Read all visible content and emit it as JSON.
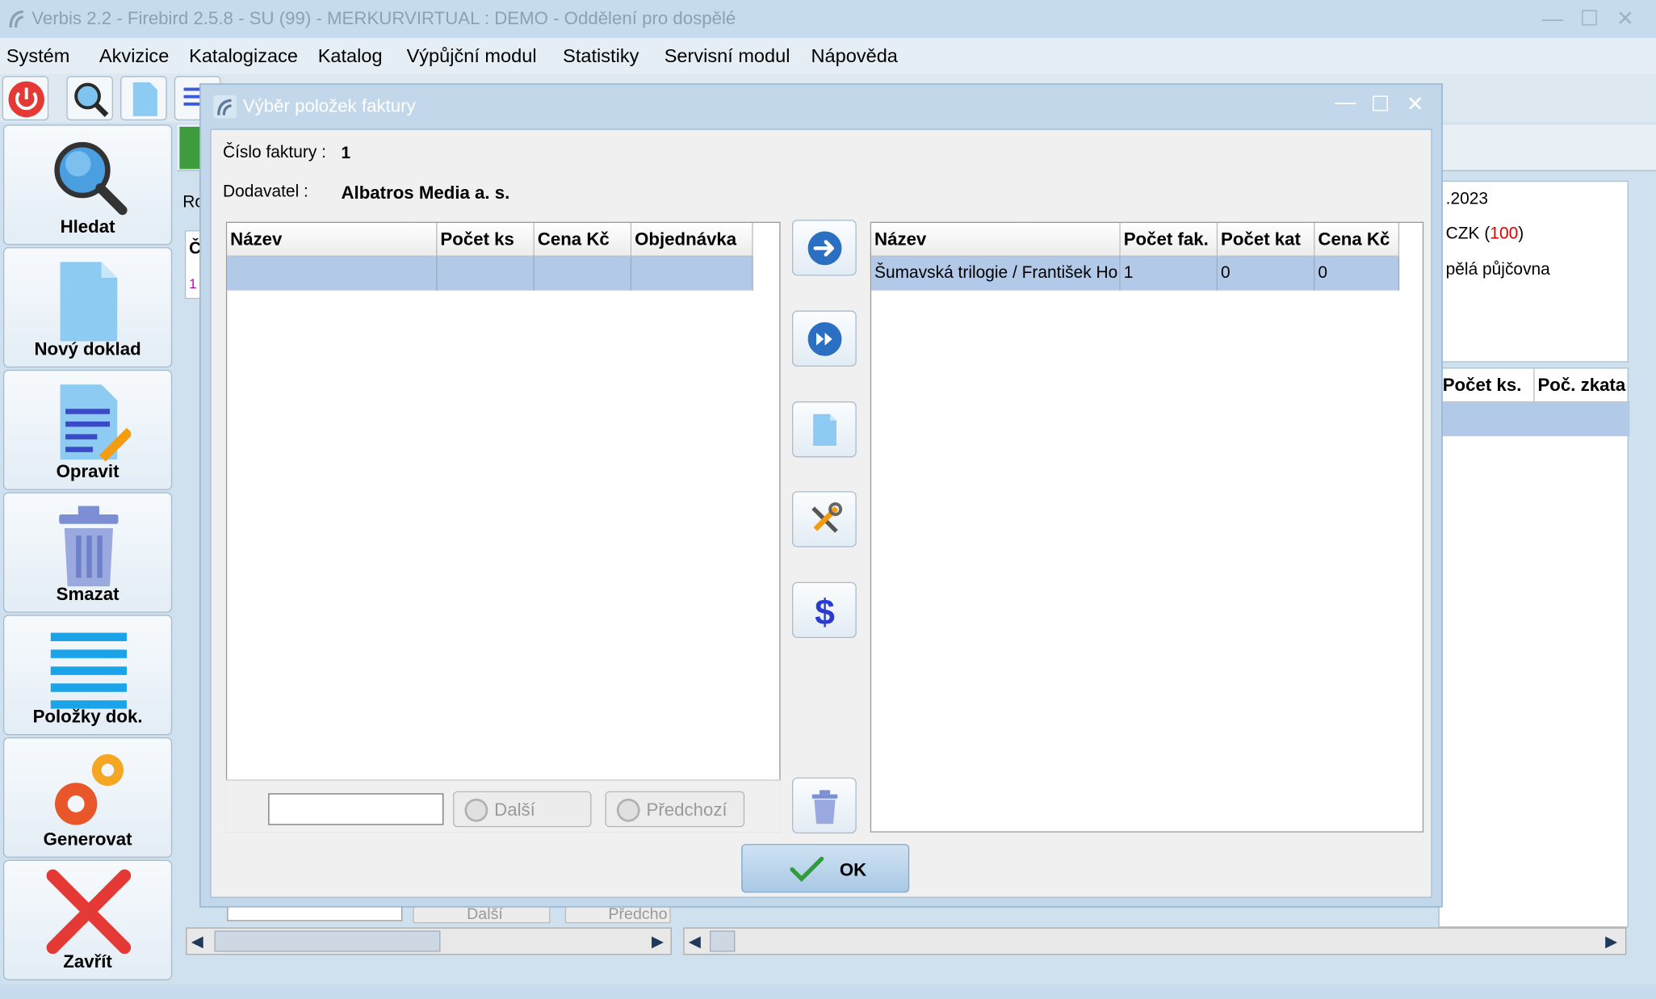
{
  "window": {
    "title": "Verbis 2.2 - Firebird 2.5.8 - SU (99) - MERKURVIRTUAL : DEMO - Oddělení pro dospělé"
  },
  "menu": [
    "Systém",
    "Akvizice",
    "Katalogizace",
    "Katalog",
    "Výpůjční modul",
    "Statistiky",
    "Servisní modul",
    "Nápověda"
  ],
  "left_buttons": {
    "hledat": "Hledat",
    "novy": "Nový doklad",
    "opravit": "Opravit",
    "smazat": "Smazat",
    "polozky": "Položky dok.",
    "generovat": "Generovat",
    "zavrit": "Zavřít"
  },
  "background": {
    "left_label": "Ro",
    "left_header": "Č",
    "left_cell": "1",
    "date": ".2023",
    "currency_prefix": "CZK (",
    "currency_value": "100",
    "currency_suffix": ")",
    "location": "pělá půjčovna",
    "col1": "Počet ks.",
    "col2": "Poč. zkata",
    "bg_next": "Další",
    "bg_prev": "Předcho"
  },
  "dialog": {
    "title": "Výběr položek faktury",
    "invoice_label": "Číslo faktury :",
    "invoice_value": "1",
    "supplier_label": "Dodavatel :",
    "supplier_value": "Albatros Media a. s.",
    "left_grid": {
      "headers": [
        "Název",
        "Počet ks",
        "Cena Kč",
        "Objednávka"
      ],
      "rows": [
        [
          "",
          "",
          "",
          ""
        ]
      ]
    },
    "right_grid": {
      "headers": [
        "Název",
        "Počet fak.",
        "Počet kat",
        "Cena Kč"
      ],
      "rows": [
        [
          "Šumavská trilogie / František Ho",
          "1",
          "0",
          "0"
        ]
      ]
    },
    "search_value": "",
    "next_label": "Další",
    "prev_label": "Předchozí",
    "ok_label": "OK"
  },
  "colors": {
    "selection": "#b3c9e8",
    "accent_blue": "#2a6fc2",
    "red": "#e53935",
    "orange": "#f39c12"
  }
}
